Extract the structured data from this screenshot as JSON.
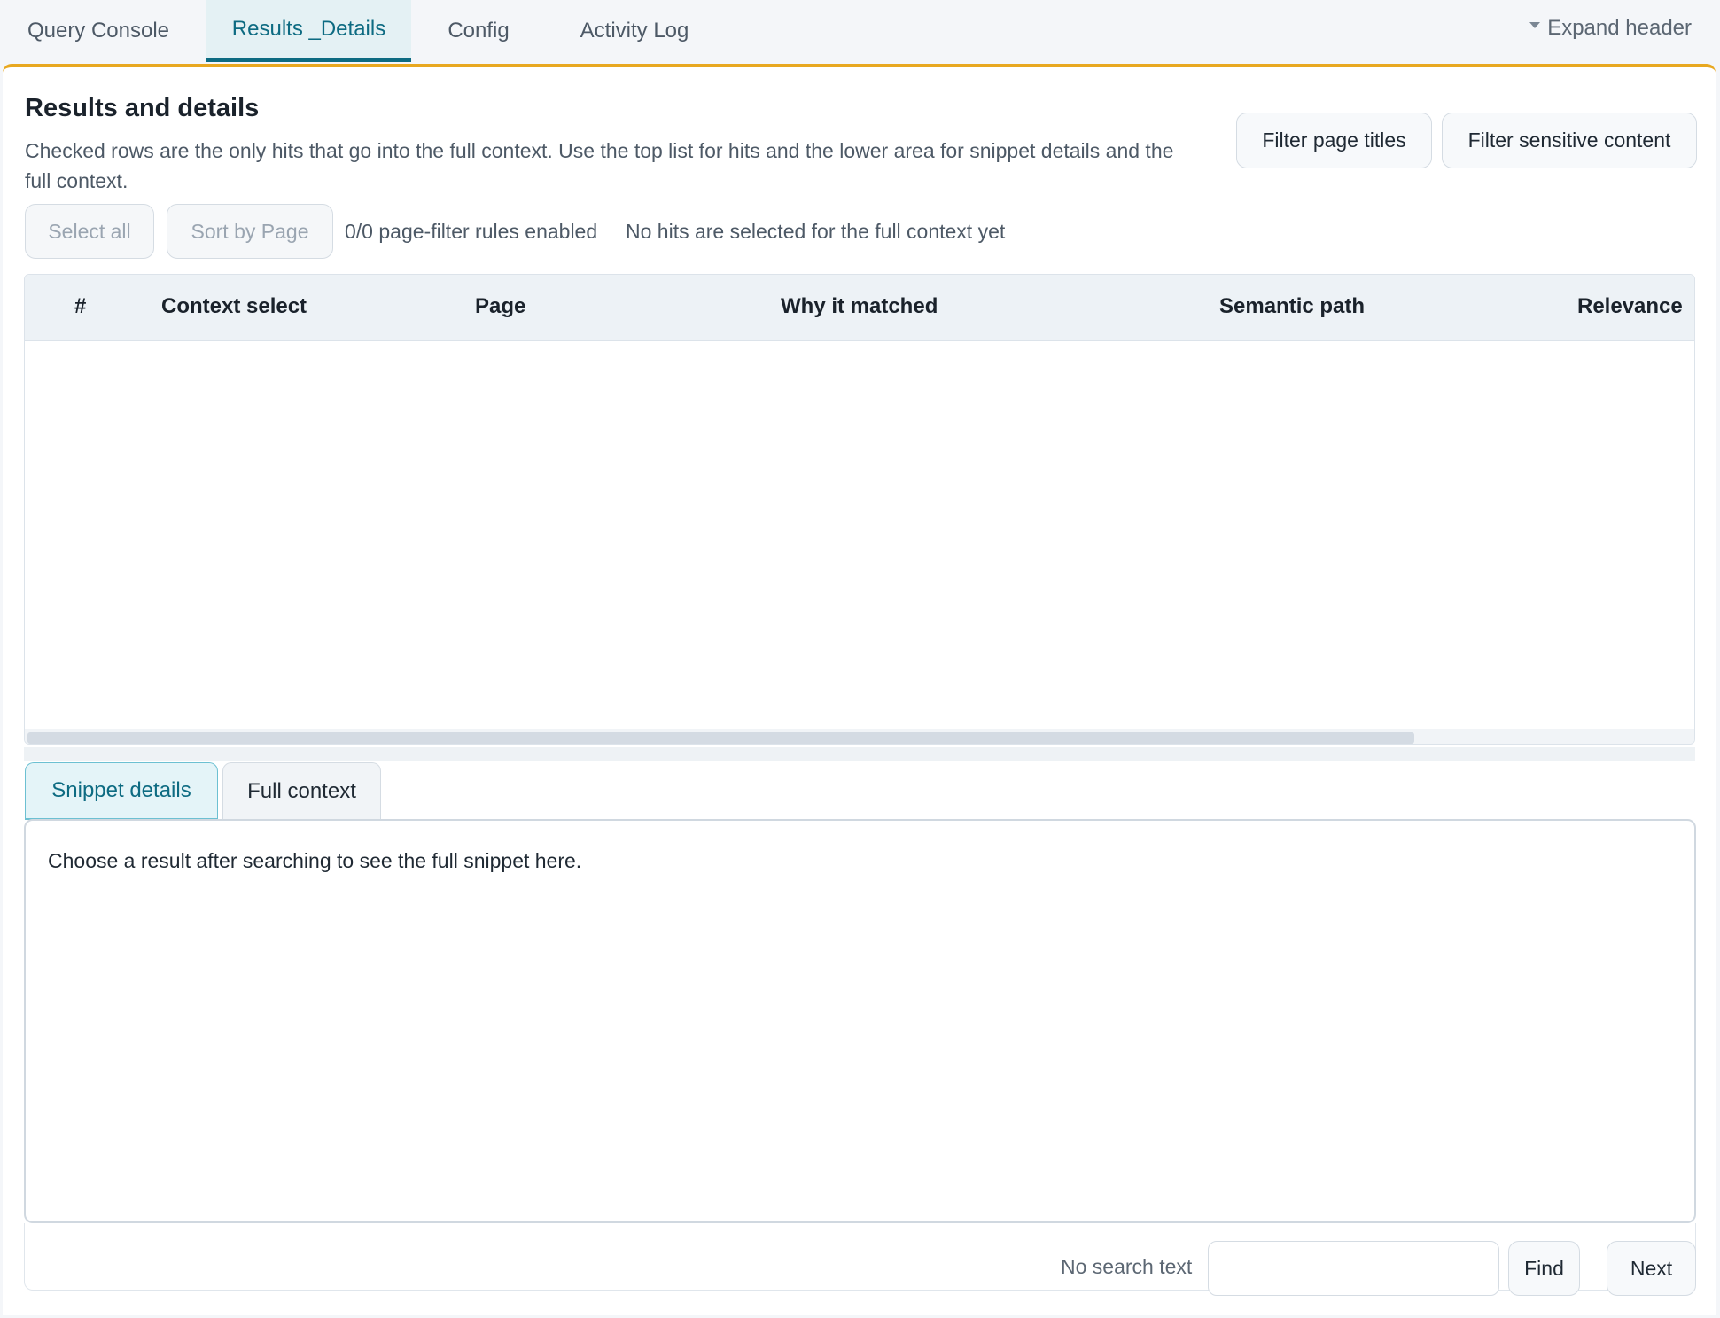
{
  "tabs": [
    {
      "label": "Query Console",
      "active": false
    },
    {
      "label": "Results _Details",
      "active": true
    },
    {
      "label": "Config",
      "active": false
    },
    {
      "label": "Activity Log",
      "active": false
    }
  ],
  "header": {
    "expand_label": "Expand header"
  },
  "section": {
    "title": "Results and details",
    "description": "Checked rows are the only hits that go into the full context. Use the top list for hits and the lower area for snippet details and the full context."
  },
  "filters": {
    "page_titles_label": "Filter page titles",
    "sensitive_label": "Filter sensitive content"
  },
  "toolbar": {
    "select_all_label": "Select all",
    "sort_label": "Sort by Page",
    "rules_status": "0/0 page-filter rules enabled",
    "selection_status": "No hits are selected for the full context yet"
  },
  "table": {
    "columns": [
      "#",
      "Context select",
      "Page",
      "Why it matched",
      "Semantic path",
      "Relevance"
    ],
    "rows": []
  },
  "detail_tabs": [
    {
      "label": "Snippet details",
      "active": true
    },
    {
      "label": "Full context",
      "active": false
    }
  ],
  "detail": {
    "placeholder_text": "Choose a result after searching to see the full snippet here."
  },
  "search": {
    "status": "No search text",
    "value": "",
    "find_label": "Find",
    "next_label": "Next"
  },
  "colors": {
    "accent": "#0d6b82",
    "panel_border": "#e8a820"
  }
}
